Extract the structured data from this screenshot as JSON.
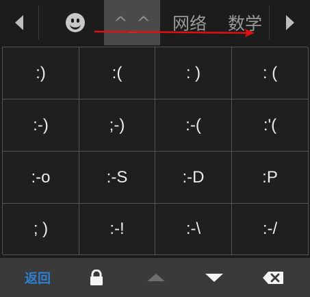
{
  "topbar": {
    "tabs": [
      {
        "label": "^_^",
        "selected": true
      },
      {
        "label": "网络"
      },
      {
        "label": "数学"
      }
    ],
    "emoji_tab_icon": "smiley-icon",
    "prev_icon": "triangle-left-icon",
    "next_icon": "triangle-right-icon"
  },
  "grid": [
    ":)",
    ":(",
    ": )",
    ": (",
    ":-)",
    ";-)",
    ":-(",
    ":'(",
    ":-o",
    ":-S",
    ":-D",
    ":P",
    "; )",
    ":-!",
    ":-\\",
    ":-/"
  ],
  "bottombar": {
    "back_label": "返回",
    "lock_icon": "lock-icon",
    "up_icon": "triangle-up-icon",
    "down_icon": "triangle-down-icon",
    "delete_icon": "backspace-icon"
  },
  "colors": {
    "background": "#1c1c1c",
    "selected_tab": "#4a4a4a",
    "bottom_bar": "#3a3a3a",
    "back_text": "#2f7fd0",
    "annotation_arrow": "#e01010"
  }
}
